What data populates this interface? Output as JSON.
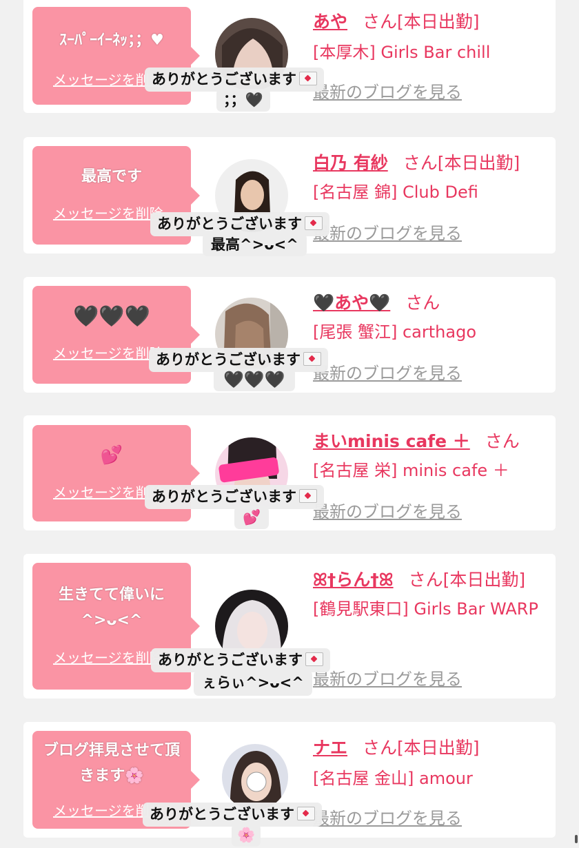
{
  "labels": {
    "san": "さん",
    "delete_message": "メッセージを削除",
    "view_blog": "最新のブログを見る"
  },
  "cards": [
    {
      "bubble_text": "ｽｰﾊﾟｰｲｰﾈｯ；；♥",
      "name": "あや",
      "status": "[本日出勤]",
      "shop": "[本厚木] Girls Bar chill",
      "toast_title": "ありがとうございます",
      "toast_sub": "；；🖤"
    },
    {
      "bubble_text": "最高です",
      "name": "白乃 有紗",
      "status": "[本日出勤]",
      "shop": "[名古屋 錦] Club Defi",
      "toast_title": "ありがとうございます",
      "toast_sub": "最高^>ᴗ<^"
    },
    {
      "bubble_text": "🖤🖤🖤",
      "name": "🖤あや🖤",
      "status": "",
      "shop": "[尾張 蟹江] carthago",
      "toast_title": "ありがとうございます",
      "toast_sub": "🖤🖤🖤"
    },
    {
      "bubble_text": "💕",
      "name": "まいminis cafe ＋",
      "status": "",
      "shop": "[名古屋 栄] minis cafe ＋",
      "toast_title": "ありがとうございます",
      "toast_sub": "💕"
    },
    {
      "bubble_text": "生きてて偉いに^>ᴗ<^",
      "name": "ꕤ†らん†ꕤ",
      "status": "[本日出勤]",
      "shop": "[鶴見駅東口] Girls Bar WARP",
      "toast_title": "ありがとうございます",
      "toast_sub": "ぇらぃ^>ᴗ<^"
    },
    {
      "bubble_text": "ブログ拝見させて頂きます🌸",
      "name": "ナエ",
      "status": "[本日出勤]",
      "shop": "[名古屋 金山] amour",
      "toast_title": "ありがとうございます",
      "toast_sub": "🌸"
    }
  ],
  "colors": {
    "accent": "#e8375f",
    "bubble": "#fa94a4",
    "background": "#f1f1f1",
    "link_gray": "#9a9a9a"
  },
  "icons": [
    "envelope-heart-icon",
    "avatar-photo"
  ]
}
